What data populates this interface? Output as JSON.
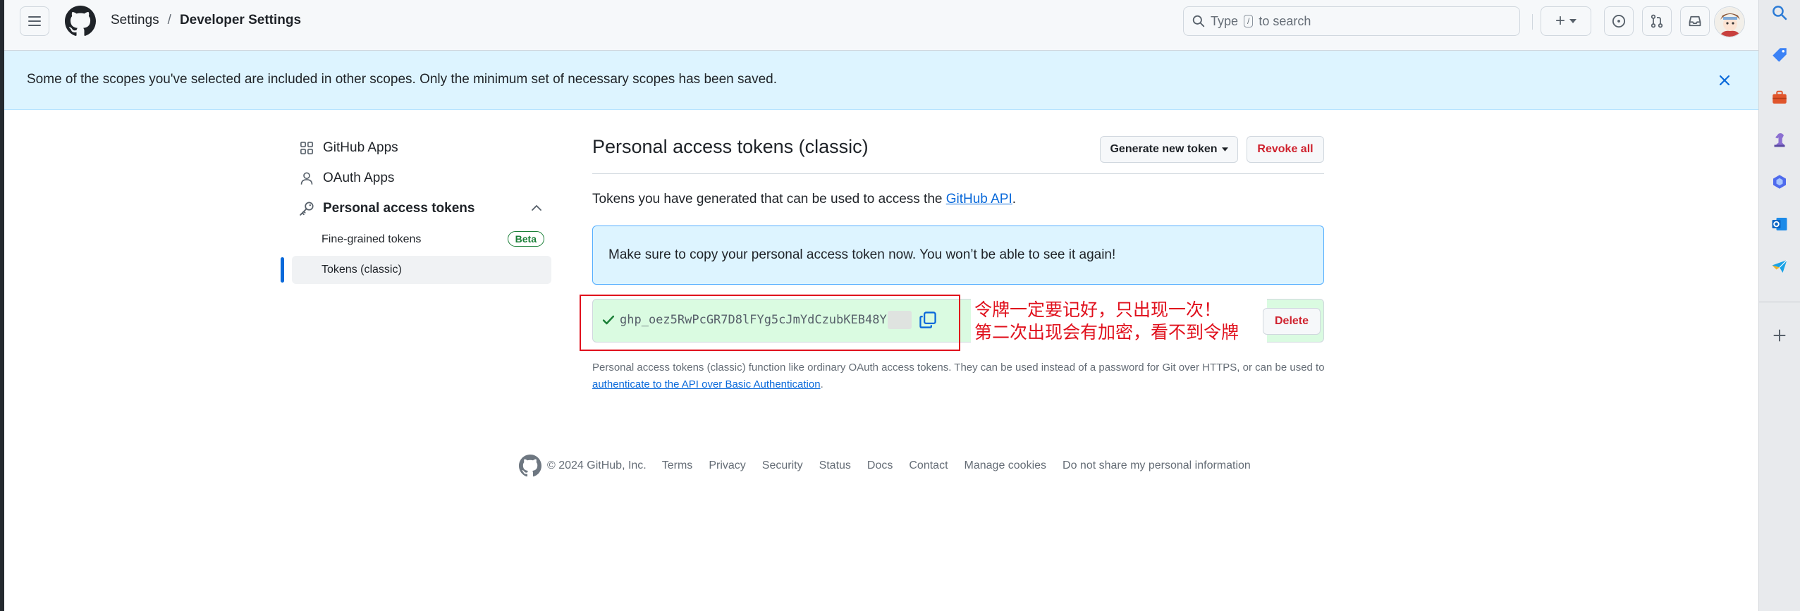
{
  "header": {
    "breadcrumb": {
      "settings": "Settings",
      "separator": "/",
      "current": "Developer Settings"
    },
    "search": {
      "prefix": "Type",
      "key": "/",
      "suffix": "to search"
    },
    "add_label": "+"
  },
  "banner": {
    "message": "Some of the scopes you've selected are included in other scopes. Only the minimum set of necessary scopes has been saved."
  },
  "sidebar": {
    "items": [
      {
        "label": "GitHub Apps",
        "icon": "apps-grid-icon"
      },
      {
        "label": "OAuth Apps",
        "icon": "person-icon"
      },
      {
        "label": "Personal access tokens",
        "icon": "key-icon"
      }
    ],
    "sub_items": [
      {
        "label": "Fine-grained tokens",
        "badge": "Beta"
      },
      {
        "label": "Tokens (classic)"
      }
    ]
  },
  "main": {
    "title": "Personal access tokens (classic)",
    "generate_button": "Generate new token",
    "revoke_button": "Revoke all",
    "description_prefix": "Tokens you have generated that can be used to access the ",
    "description_link": "GitHub API",
    "description_suffix": ".",
    "flash": "Make sure to copy your personal access token now. You won’t be able to see it again!",
    "token_value": "ghp_oez5RwPcGR7D8lFYg5cJmYdCzubKEB48Y",
    "delete_button": "Delete",
    "annotation_line1": "令牌一定要记好，只出现一次！",
    "annotation_line2": "第二次出现会有加密，看不到令牌",
    "help_text": "Personal access tokens (classic) function like ordinary OAuth access tokens. They can be used instead of a password for Git over HTTPS, or can be used to ",
    "help_link": "authenticate to the API over Basic Authentication",
    "help_suffix": "."
  },
  "footer": {
    "copyright": "© 2024 GitHub, Inc.",
    "links": [
      "Terms",
      "Privacy",
      "Security",
      "Status",
      "Docs",
      "Contact",
      "Manage cookies",
      "Do not share my personal information"
    ]
  },
  "colors": {
    "accent": "#0969da",
    "danger": "#cf222e",
    "success": "#1a7f37",
    "annotation_red": "#e0101c",
    "banner_bg": "#ddf4ff"
  }
}
